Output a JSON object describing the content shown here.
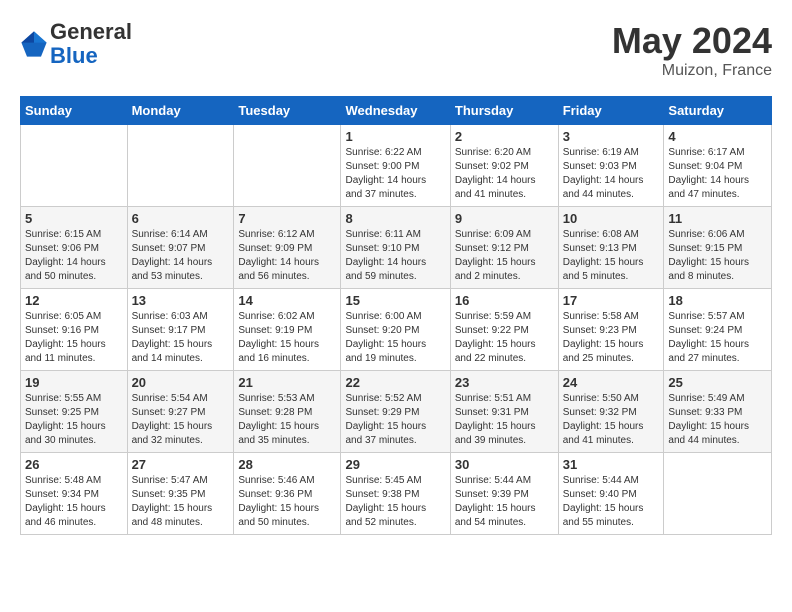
{
  "header": {
    "logo_line1": "General",
    "logo_line2": "Blue",
    "main_title": "May 2024",
    "subtitle": "Muizon, France"
  },
  "calendar": {
    "weekdays": [
      "Sunday",
      "Monday",
      "Tuesday",
      "Wednesday",
      "Thursday",
      "Friday",
      "Saturday"
    ],
    "weeks": [
      [
        {
          "day": "",
          "info": ""
        },
        {
          "day": "",
          "info": ""
        },
        {
          "day": "",
          "info": ""
        },
        {
          "day": "1",
          "info": "Sunrise: 6:22 AM\nSunset: 9:00 PM\nDaylight: 14 hours\nand 37 minutes."
        },
        {
          "day": "2",
          "info": "Sunrise: 6:20 AM\nSunset: 9:02 PM\nDaylight: 14 hours\nand 41 minutes."
        },
        {
          "day": "3",
          "info": "Sunrise: 6:19 AM\nSunset: 9:03 PM\nDaylight: 14 hours\nand 44 minutes."
        },
        {
          "day": "4",
          "info": "Sunrise: 6:17 AM\nSunset: 9:04 PM\nDaylight: 14 hours\nand 47 minutes."
        }
      ],
      [
        {
          "day": "5",
          "info": "Sunrise: 6:15 AM\nSunset: 9:06 PM\nDaylight: 14 hours\nand 50 minutes."
        },
        {
          "day": "6",
          "info": "Sunrise: 6:14 AM\nSunset: 9:07 PM\nDaylight: 14 hours\nand 53 minutes."
        },
        {
          "day": "7",
          "info": "Sunrise: 6:12 AM\nSunset: 9:09 PM\nDaylight: 14 hours\nand 56 minutes."
        },
        {
          "day": "8",
          "info": "Sunrise: 6:11 AM\nSunset: 9:10 PM\nDaylight: 14 hours\nand 59 minutes."
        },
        {
          "day": "9",
          "info": "Sunrise: 6:09 AM\nSunset: 9:12 PM\nDaylight: 15 hours\nand 2 minutes."
        },
        {
          "day": "10",
          "info": "Sunrise: 6:08 AM\nSunset: 9:13 PM\nDaylight: 15 hours\nand 5 minutes."
        },
        {
          "day": "11",
          "info": "Sunrise: 6:06 AM\nSunset: 9:15 PM\nDaylight: 15 hours\nand 8 minutes."
        }
      ],
      [
        {
          "day": "12",
          "info": "Sunrise: 6:05 AM\nSunset: 9:16 PM\nDaylight: 15 hours\nand 11 minutes."
        },
        {
          "day": "13",
          "info": "Sunrise: 6:03 AM\nSunset: 9:17 PM\nDaylight: 15 hours\nand 14 minutes."
        },
        {
          "day": "14",
          "info": "Sunrise: 6:02 AM\nSunset: 9:19 PM\nDaylight: 15 hours\nand 16 minutes."
        },
        {
          "day": "15",
          "info": "Sunrise: 6:00 AM\nSunset: 9:20 PM\nDaylight: 15 hours\nand 19 minutes."
        },
        {
          "day": "16",
          "info": "Sunrise: 5:59 AM\nSunset: 9:22 PM\nDaylight: 15 hours\nand 22 minutes."
        },
        {
          "day": "17",
          "info": "Sunrise: 5:58 AM\nSunset: 9:23 PM\nDaylight: 15 hours\nand 25 minutes."
        },
        {
          "day": "18",
          "info": "Sunrise: 5:57 AM\nSunset: 9:24 PM\nDaylight: 15 hours\nand 27 minutes."
        }
      ],
      [
        {
          "day": "19",
          "info": "Sunrise: 5:55 AM\nSunset: 9:25 PM\nDaylight: 15 hours\nand 30 minutes."
        },
        {
          "day": "20",
          "info": "Sunrise: 5:54 AM\nSunset: 9:27 PM\nDaylight: 15 hours\nand 32 minutes."
        },
        {
          "day": "21",
          "info": "Sunrise: 5:53 AM\nSunset: 9:28 PM\nDaylight: 15 hours\nand 35 minutes."
        },
        {
          "day": "22",
          "info": "Sunrise: 5:52 AM\nSunset: 9:29 PM\nDaylight: 15 hours\nand 37 minutes."
        },
        {
          "day": "23",
          "info": "Sunrise: 5:51 AM\nSunset: 9:31 PM\nDaylight: 15 hours\nand 39 minutes."
        },
        {
          "day": "24",
          "info": "Sunrise: 5:50 AM\nSunset: 9:32 PM\nDaylight: 15 hours\nand 41 minutes."
        },
        {
          "day": "25",
          "info": "Sunrise: 5:49 AM\nSunset: 9:33 PM\nDaylight: 15 hours\nand 44 minutes."
        }
      ],
      [
        {
          "day": "26",
          "info": "Sunrise: 5:48 AM\nSunset: 9:34 PM\nDaylight: 15 hours\nand 46 minutes."
        },
        {
          "day": "27",
          "info": "Sunrise: 5:47 AM\nSunset: 9:35 PM\nDaylight: 15 hours\nand 48 minutes."
        },
        {
          "day": "28",
          "info": "Sunrise: 5:46 AM\nSunset: 9:36 PM\nDaylight: 15 hours\nand 50 minutes."
        },
        {
          "day": "29",
          "info": "Sunrise: 5:45 AM\nSunset: 9:38 PM\nDaylight: 15 hours\nand 52 minutes."
        },
        {
          "day": "30",
          "info": "Sunrise: 5:44 AM\nSunset: 9:39 PM\nDaylight: 15 hours\nand 54 minutes."
        },
        {
          "day": "31",
          "info": "Sunrise: 5:44 AM\nSunset: 9:40 PM\nDaylight: 15 hours\nand 55 minutes."
        },
        {
          "day": "",
          "info": ""
        }
      ]
    ]
  }
}
